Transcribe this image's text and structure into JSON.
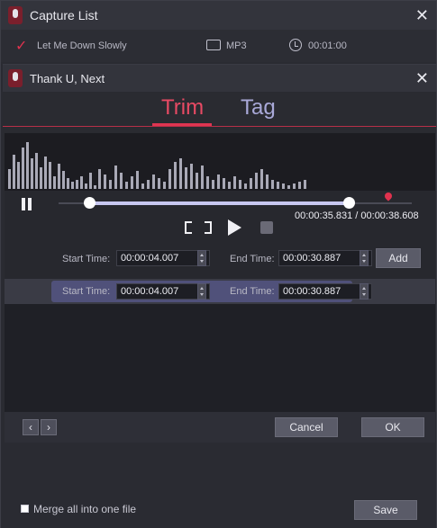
{
  "window": {
    "title": "Capture List"
  },
  "capture": {
    "song": "Let Me Down Slowly",
    "format": "MP3",
    "duration": "00:01:00"
  },
  "dialog": {
    "title": "Thank U, Next"
  },
  "tabs": [
    {
      "label": "Trim",
      "active": true
    },
    {
      "label": "Tag",
      "active": false
    }
  ],
  "player": {
    "time_readout": "00:00:35.831 / 00:00:38.608"
  },
  "trim": {
    "start_label": "Start Time:",
    "start_value": "00:00:04.007",
    "end_label": "End Time:",
    "end_value": "00:00:30.887",
    "add_label": "Add"
  },
  "segment": {
    "start_label": "Start Time:",
    "start_value": "00:00:04.007",
    "end_label": "End Time:",
    "end_value": "00:00:30.887"
  },
  "buttons": {
    "cancel": "Cancel",
    "ok": "OK",
    "save": "Save"
  },
  "footer": {
    "merge_label": "Merge all into one file"
  },
  "colors": {
    "accent": "#e0324e",
    "tab_inactive": "#a9a9d8",
    "selection": "#c7c7f0"
  },
  "icons": {
    "prev": "chevron-left-icon",
    "next": "chevron-right-icon"
  }
}
